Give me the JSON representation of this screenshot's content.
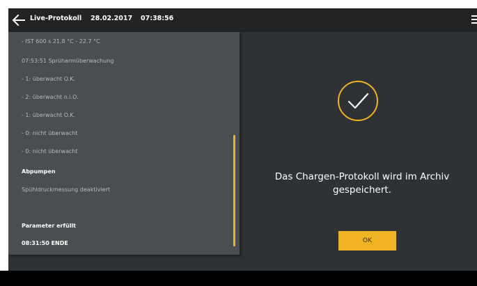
{
  "header": {
    "title": "Live-Protokoll",
    "date": "28.02.2017",
    "time": "07:38:56"
  },
  "icons": {
    "back": "arrow-left",
    "menu": "hamburger-menu",
    "success": "check-circle"
  },
  "log": {
    "lines": [
      {
        "text": "- IST 600 s 21.8 °C - 22.7 °C",
        "bold": false
      },
      {
        "text": "07:53:51 Sprüharmüberwachung",
        "bold": false
      },
      {
        "text": "- 1: überwacht O.K.",
        "bold": false
      },
      {
        "text": "- 2: überwacht n.i.O.",
        "bold": false
      },
      {
        "text": "- 1: überwacht O.K.",
        "bold": false
      },
      {
        "text": "- 0: nicht überwacht",
        "bold": false
      },
      {
        "text": "- 0: nicht überwacht",
        "bold": false
      },
      {
        "text": "Abpumpen",
        "bold": true
      },
      {
        "text": "Spühldruckmessung deaktiviert",
        "bold": false
      },
      {
        "text": "Parameter erfüllt",
        "bold": true
      },
      {
        "text": "08:31:50 ENDE",
        "bold": true
      }
    ]
  },
  "dialog": {
    "message_line1": "Das Chargen-Protokoll wird im Archiv",
    "message_line2": "gespeichert.",
    "ok_label": "OK"
  },
  "colors": {
    "accent": "#f0b323",
    "topbar": "#212325",
    "background": "#2f3234",
    "panel": "#4b4e50"
  }
}
